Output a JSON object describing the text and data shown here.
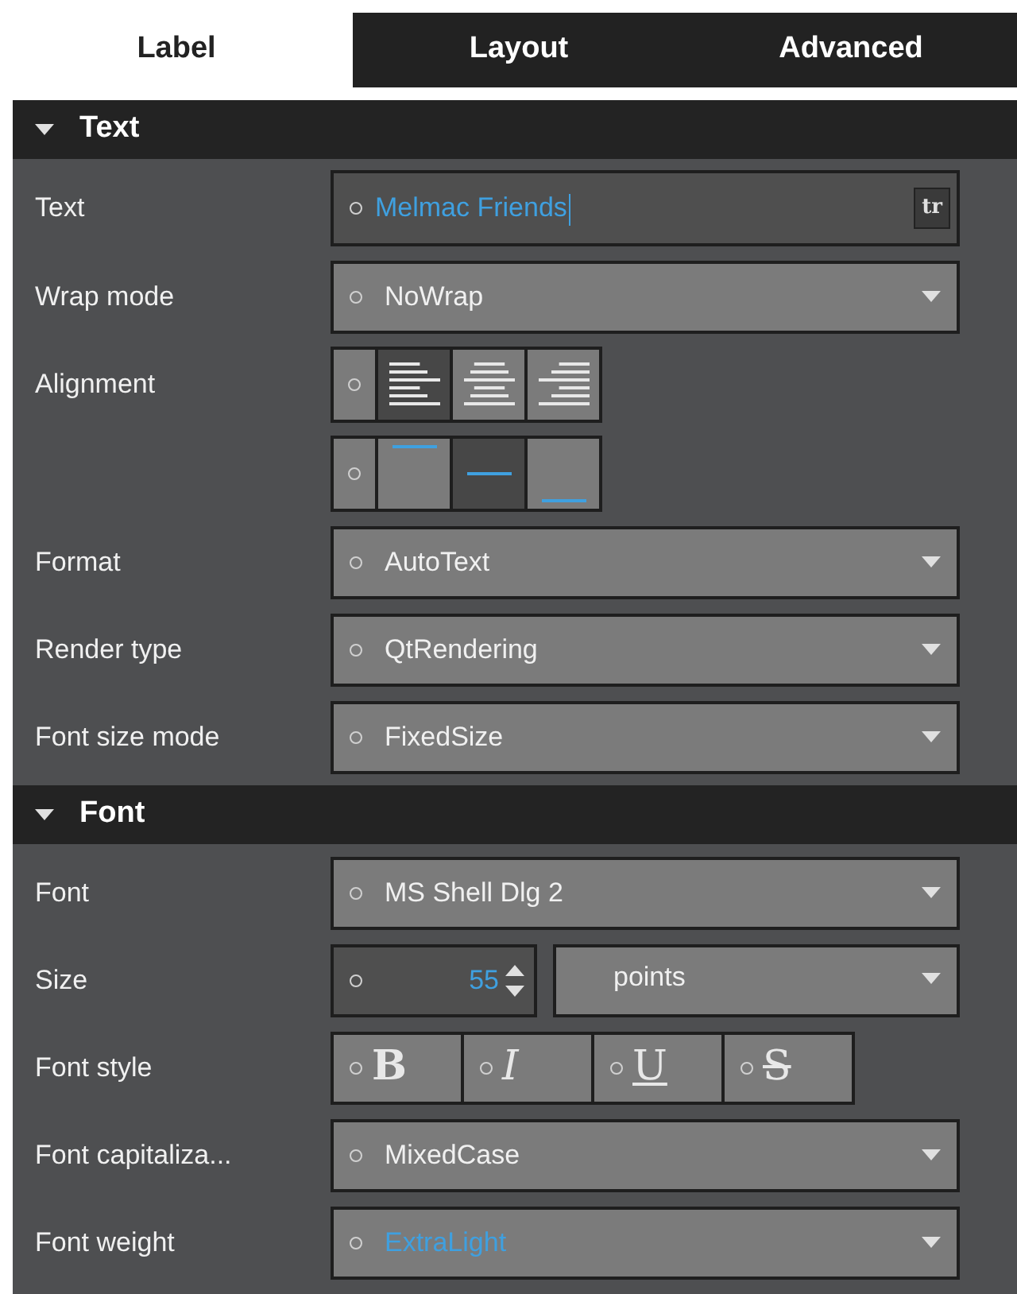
{
  "tabs": [
    {
      "label": "Label",
      "selected": true
    },
    {
      "label": "Layout",
      "selected": false
    },
    {
      "label": "Advanced",
      "selected": false
    }
  ],
  "sections": [
    {
      "title": "Text",
      "expanded": true,
      "rows": [
        {
          "kind": "text",
          "label": "Text",
          "value": "Melmac Friends",
          "button": "tr"
        },
        {
          "kind": "combo",
          "label": "Wrap mode",
          "value": "NoWrap"
        },
        {
          "kind": "halign",
          "label": "Alignment",
          "options": [
            {
              "kind": "left",
              "selected": true
            },
            {
              "kind": "center",
              "selected": false
            },
            {
              "kind": "right",
              "selected": false
            }
          ]
        },
        {
          "kind": "valign",
          "options": [
            {
              "kind": "top",
              "selected": false
            },
            {
              "kind": "middle",
              "selected": true
            },
            {
              "kind": "bottom",
              "selected": false
            }
          ]
        },
        {
          "kind": "combo",
          "label": "Format",
          "value": "AutoText"
        },
        {
          "kind": "combo",
          "label": "Render type",
          "value": "QtRendering"
        },
        {
          "kind": "combo",
          "label": "Font size mode",
          "value": "FixedSize"
        }
      ]
    },
    {
      "title": "Font",
      "expanded": true,
      "rows": [
        {
          "kind": "combo",
          "label": "Font",
          "value": "MS Shell Dlg 2"
        },
        {
          "kind": "size",
          "label": "Size",
          "value": "55",
          "unit": "points"
        },
        {
          "kind": "style",
          "label": "Font style",
          "options": [
            {
              "kind": "bold",
              "glyph": "B",
              "selected": false
            },
            {
              "kind": "italic",
              "glyph": "I",
              "selected": false
            },
            {
              "kind": "underline",
              "glyph": "U",
              "selected": false
            },
            {
              "kind": "strike",
              "glyph": "S",
              "selected": false
            }
          ]
        },
        {
          "kind": "combo",
          "label": "Font capitaliza...",
          "value": "MixedCase"
        },
        {
          "kind": "combo",
          "label": "Font weight",
          "value": "ExtraLight",
          "highlight": true
        }
      ]
    }
  ]
}
